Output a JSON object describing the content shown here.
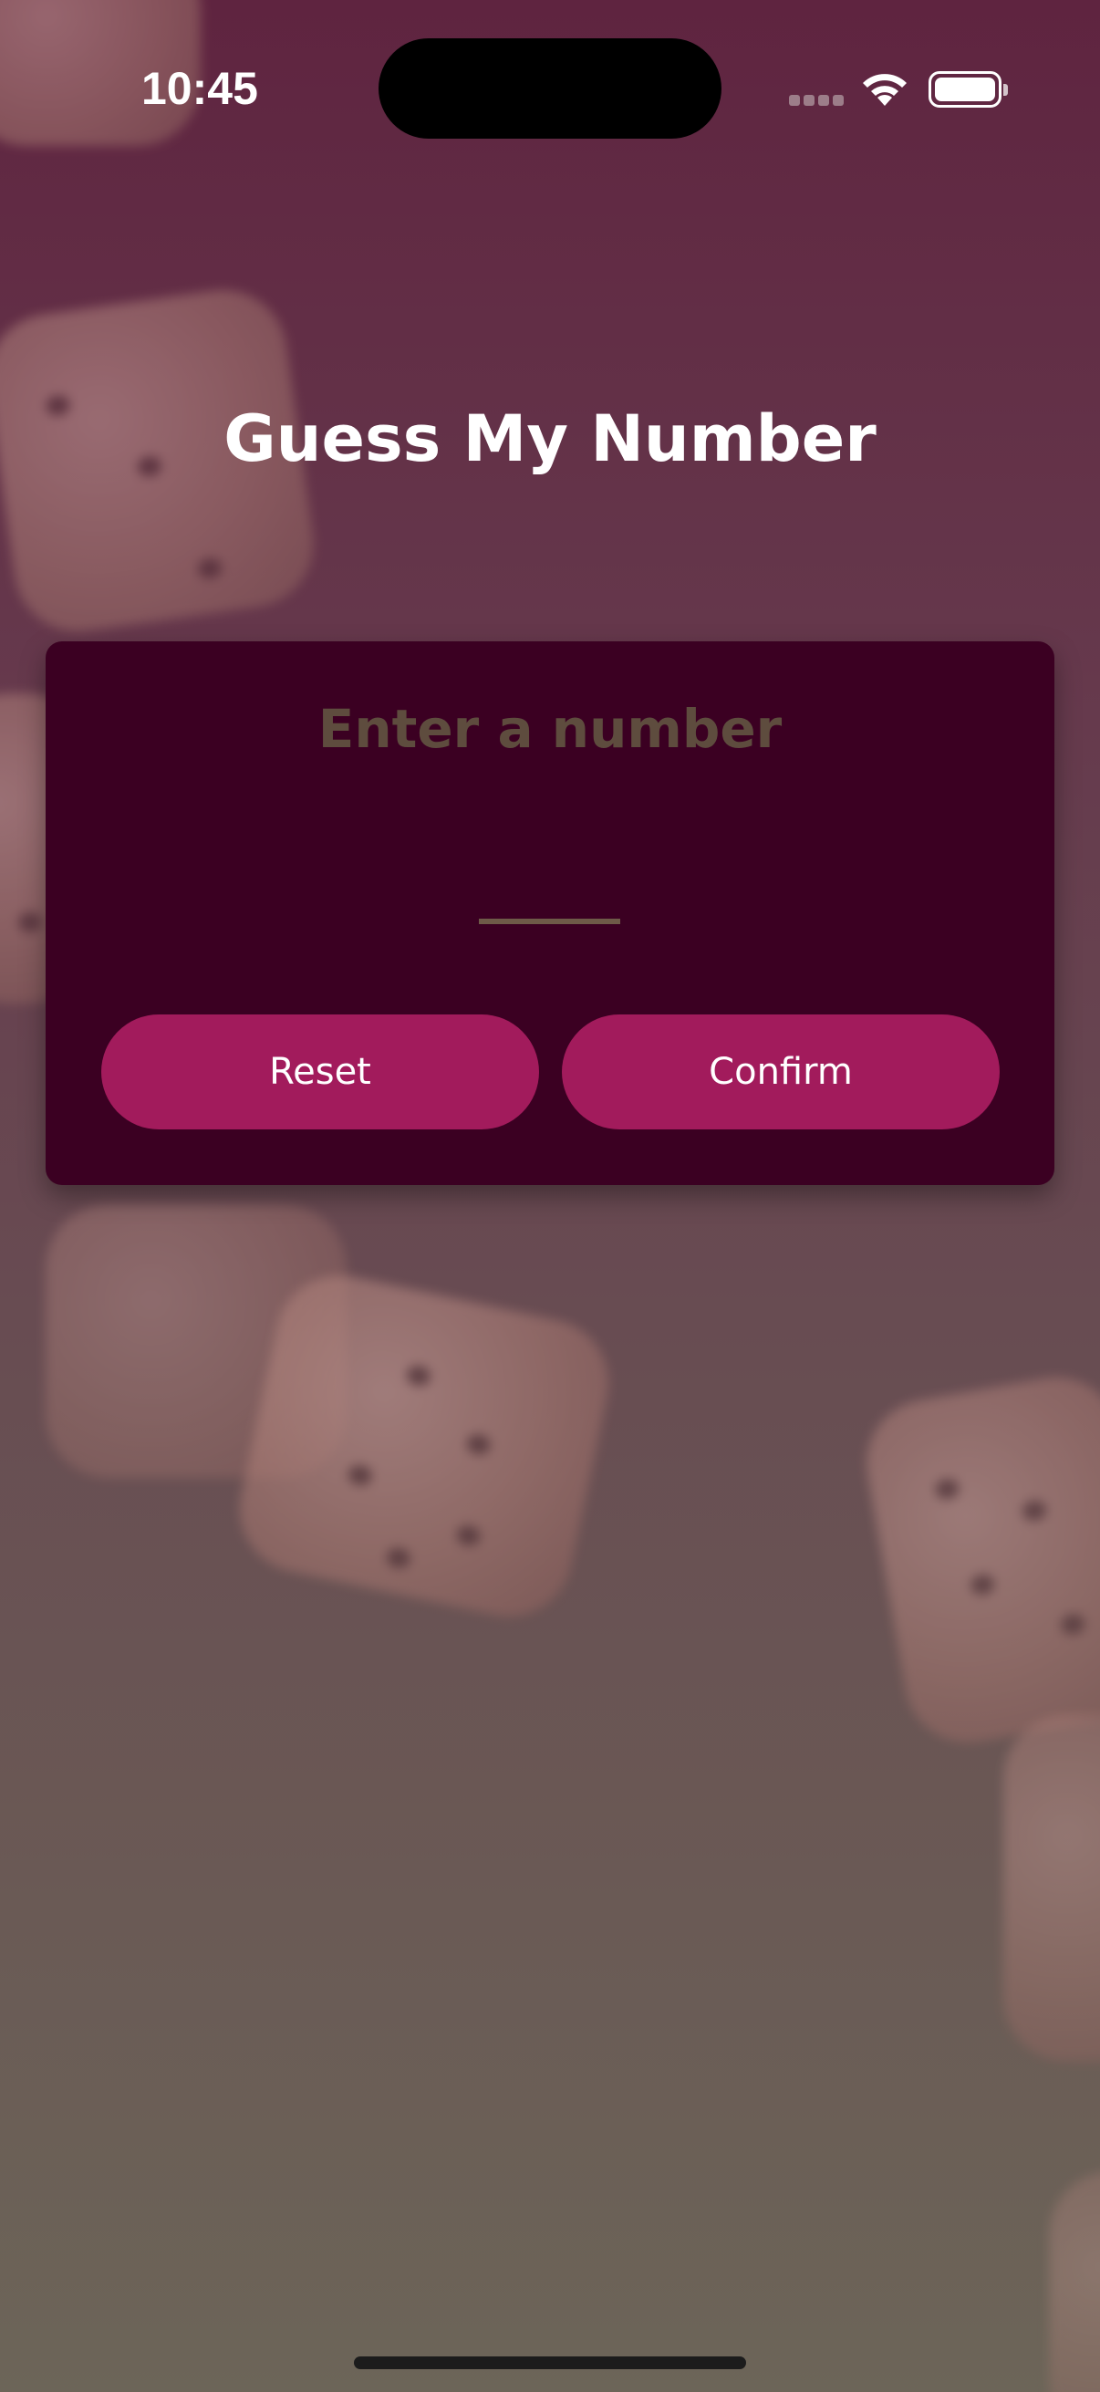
{
  "status_bar": {
    "time": "10:45",
    "signal_icon": "cellular-signal-icon",
    "wifi_icon": "wifi-icon",
    "battery_icon": "battery-icon"
  },
  "screen": {
    "title": "Guess My Number"
  },
  "card": {
    "prompt": "Enter a number",
    "input": {
      "value": "",
      "placeholder": ""
    },
    "reset_label": "Reset",
    "confirm_label": "Confirm"
  },
  "colors": {
    "background_top": "#5f2440",
    "background_bottom": "#6c6558",
    "card": "#3b0022",
    "button": "#a21b5c",
    "accent_line": "#6e5a48",
    "prompt_text": "#5e4c3e"
  }
}
